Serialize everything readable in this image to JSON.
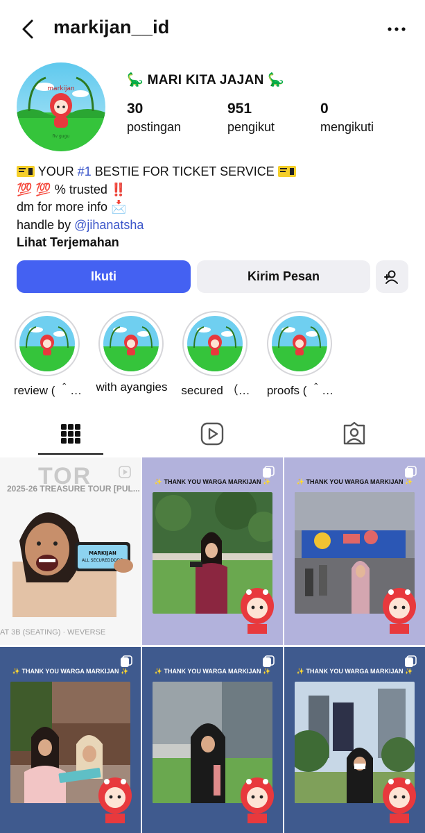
{
  "header": {
    "username": "markijan__id"
  },
  "profile": {
    "display_name": "MARI KITA JAJAN",
    "display_emoji_left": "🦕",
    "display_emoji_right": "🦕",
    "stats": [
      {
        "value": "30",
        "label": "postingan"
      },
      {
        "value": "951",
        "label": "pengikut"
      },
      {
        "value": "0",
        "label": "mengikuti"
      }
    ],
    "bio": {
      "line1_pre": "YOUR ",
      "line1_hashtag": "#1",
      "line1_post": " BESTIE FOR TICKET SERVICE",
      "line2_emoji": "💯 💯",
      "line2_text": " % trusted ",
      "line2_mark": "‼️",
      "line3_text": "dm for more info ",
      "line3_emoji": "📩",
      "line4_pre": "handle by ",
      "line4_link": "@jihanatsha",
      "translate": "Lihat Terjemahan"
    }
  },
  "actions": {
    "follow": "Ikuti",
    "message": "Kirim Pesan"
  },
  "highlights": [
    {
      "label": "review ( ＾…"
    },
    {
      "label": "with ayangies"
    },
    {
      "label": "secured （…"
    },
    {
      "label": "proofs ( ＾…"
    }
  ],
  "posts": [
    {
      "banner": "",
      "background": "#ffffff",
      "card": "MARKIJAN ALL SECUREDDDDD",
      "bg_text_1": "TOR",
      "bg_text_2": "2025-26 TREASURE TOUR [PUL...",
      "bg_text_3": "AT 3B (SEATING) · WEVERSE"
    },
    {
      "banner": "✨ THANK YOU WARGA MARKIJAN ✨",
      "background": "#b2b2dc"
    },
    {
      "banner": "✨ THANK YOU WARGA MARKIJAN ✨",
      "background": "#b2b2dc"
    },
    {
      "banner": "✨ THANK YOU WARGA MARKIJAN ✨",
      "background": "#3f5a8e"
    },
    {
      "banner": "✨ THANK YOU WARGA MARKIJAN ✨",
      "background": "#3f5a8e"
    },
    {
      "banner": "✨ THANK YOU WARGA MARKIJAN ✨",
      "background": "#3f5a8e"
    }
  ],
  "icons": {
    "back": "chevron-left-icon",
    "more": "more-horizontal-icon",
    "add_user": "add-user-icon",
    "grid": "grid-icon",
    "reels": "reels-icon",
    "tagged": "tagged-icon"
  },
  "colors": {
    "accent": "#4461f2",
    "link": "#3a55c9",
    "button_secondary": "#efeff3",
    "lavender": "#b2b2dc",
    "navy": "#3f5a8e"
  }
}
